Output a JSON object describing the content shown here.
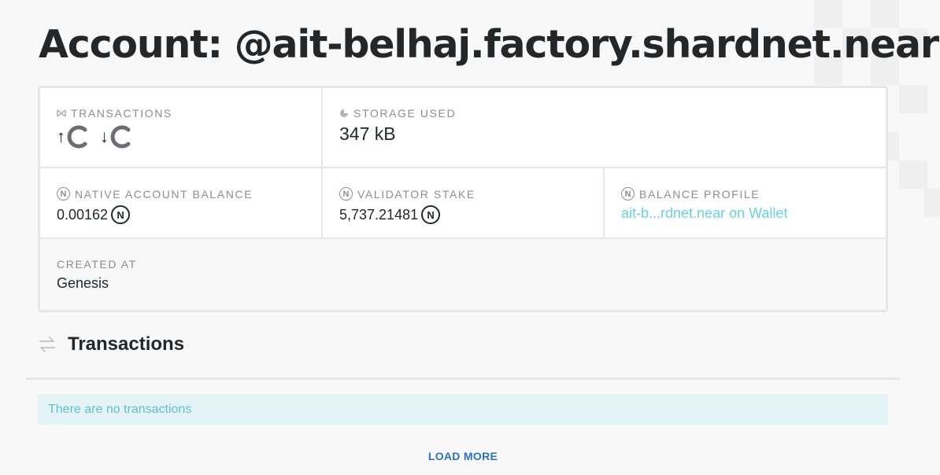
{
  "page": {
    "title": "Account: @ait-belhaj.factory.shardnet.near"
  },
  "account_card": {
    "transactions": {
      "label": "TRANSACTIONS",
      "outgoing_arrow": "↑",
      "incoming_arrow": "↓"
    },
    "storage": {
      "label": "STORAGE USED",
      "value": "347 kB"
    },
    "native_balance": {
      "label": "NATIVE ACCOUNT BALANCE",
      "value": "0.00162"
    },
    "validator_stake": {
      "label": "VALIDATOR STAKE",
      "value": "5,737.21481"
    },
    "balance_profile": {
      "label": "BALANCE PROFILE",
      "link_text": "ait-b...rdnet.near on Wallet"
    },
    "created_at": {
      "label": "CREATED AT",
      "value": "Genesis"
    },
    "near_symbol": "N"
  },
  "transactions_section": {
    "title": "Transactions",
    "empty_message": "There are no transactions",
    "load_more_label": "LOAD MORE"
  },
  "colors": {
    "accent_link": "#6ad1e3",
    "load_more": "#2b72c4",
    "empty_bg": "#e4f4f6",
    "text": "#24272a",
    "muted": "#8d8d8d"
  },
  "icons": {
    "transactions": "transactions-icon",
    "storage": "storage-pie-icon",
    "near": "near-logo-icon",
    "spinner": "loading-spinner-icon",
    "transfer": "transfer-arrows-icon"
  }
}
